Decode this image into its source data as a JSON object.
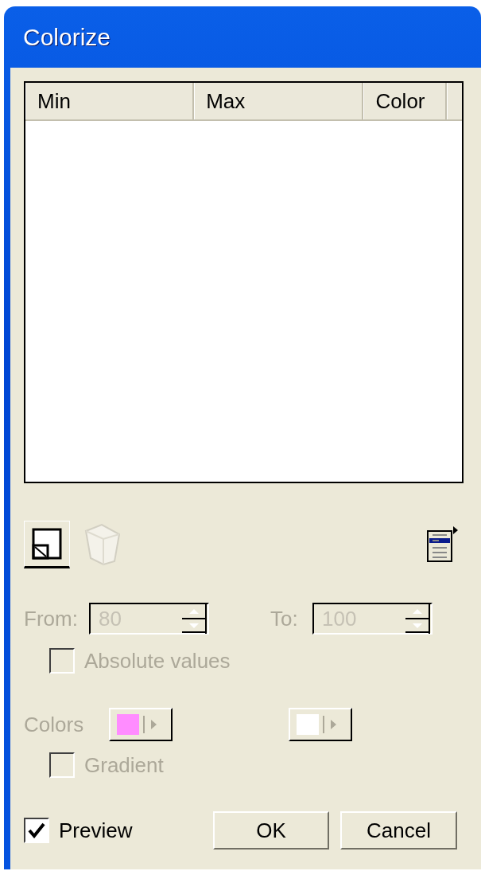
{
  "window": {
    "title": "Colorize"
  },
  "table": {
    "columns": [
      "Min",
      "Max",
      "Color"
    ]
  },
  "from": {
    "label": "From:",
    "value": "80",
    "disabled": true
  },
  "to": {
    "label": "To:",
    "value": "100",
    "disabled": true
  },
  "absolute_values": {
    "label": "Absolute values",
    "checked": false,
    "disabled": true
  },
  "colors": {
    "label": "Colors",
    "disabled": true,
    "swatches": [
      {
        "color": "#ff8cff"
      },
      {
        "color": "#ffffff"
      }
    ]
  },
  "gradient": {
    "label": "Gradient",
    "checked": false,
    "disabled": true
  },
  "preview": {
    "label": "Preview",
    "checked": true,
    "disabled": false
  },
  "buttons": [
    "OK",
    "Cancel"
  ]
}
